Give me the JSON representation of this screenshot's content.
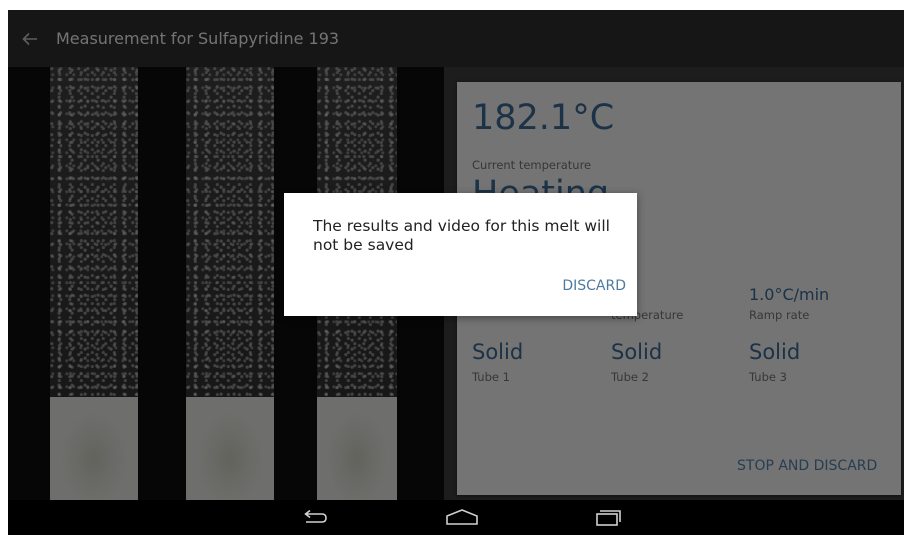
{
  "appbar": {
    "title": "Measurement for Sulfapyridine 193"
  },
  "icons": {
    "back": "arrow-left-icon",
    "nav_back": "nav-back-icon",
    "nav_home": "nav-home-icon",
    "nav_recents": "nav-recents-icon"
  },
  "status": {
    "temperature": "182.1°C",
    "temperature_label": "Current temperature",
    "state": "Heating",
    "target_value": "",
    "target_label": "temperature",
    "ramp_value": "1.0°C/min",
    "ramp_label": "Ramp rate",
    "stop_label": "STOP AND DISCARD"
  },
  "tubes": [
    {
      "state": "Solid",
      "label": "Tube 1"
    },
    {
      "state": "Solid",
      "label": "Tube 2"
    },
    {
      "state": "Solid",
      "label": "Tube 3"
    }
  ],
  "dialog": {
    "message": "The results and video for this melt will not be saved",
    "button": "DISCARD"
  },
  "colors": {
    "accent": "#37648e",
    "appbar": "#2d2d2d",
    "card": "#e8e8e8",
    "dialog_button": "#4f7aa0"
  }
}
